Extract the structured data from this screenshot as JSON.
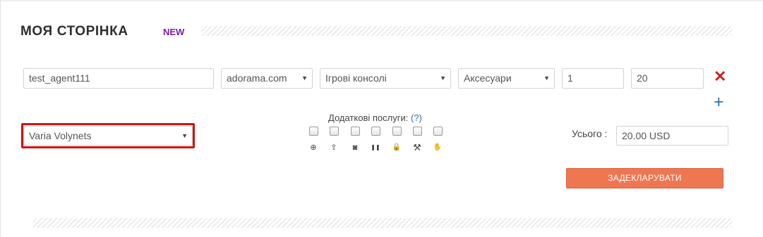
{
  "page": {
    "title": "МОЯ СТОРІНКА",
    "badge": "NEW"
  },
  "order_row": {
    "username": "test_agent111",
    "store": "adorama.com",
    "category": "Ігрові консолі",
    "subcategory": "Аксесуари",
    "quantity": "1",
    "price": "20",
    "remove_icon": "close-icon",
    "add_icon": "plus-icon"
  },
  "recipient": {
    "selected": "Varia Volynets"
  },
  "services": {
    "label": "Додаткові послуги:",
    "help": "(?)",
    "items": [
      {
        "icon": "lifebuoy-icon",
        "symbol": "⊕",
        "checked": false
      },
      {
        "icon": "screen-upload-icon",
        "symbol": "⇪",
        "checked": false
      },
      {
        "icon": "camera-icon",
        "symbol": "◙",
        "checked": false
      },
      {
        "icon": "pause-icon",
        "symbol": "❚❚",
        "checked": false
      },
      {
        "icon": "lock-icon",
        "symbol": "🔒",
        "checked": false
      },
      {
        "icon": "tools-icon",
        "symbol": "⚒",
        "checked": false
      },
      {
        "icon": "hand-icon",
        "symbol": "✋",
        "checked": false
      }
    ]
  },
  "total": {
    "label": "Усього :",
    "value": "20.00 USD"
  },
  "actions": {
    "declare": "ЗАДЕКЛАРУВАТИ"
  },
  "colors": {
    "badge": "#7b1fa2",
    "declare_button": "#ee7752",
    "remove": "#cc1f1f",
    "add": "#2f6fb3",
    "highlight": "#d50f0f"
  }
}
